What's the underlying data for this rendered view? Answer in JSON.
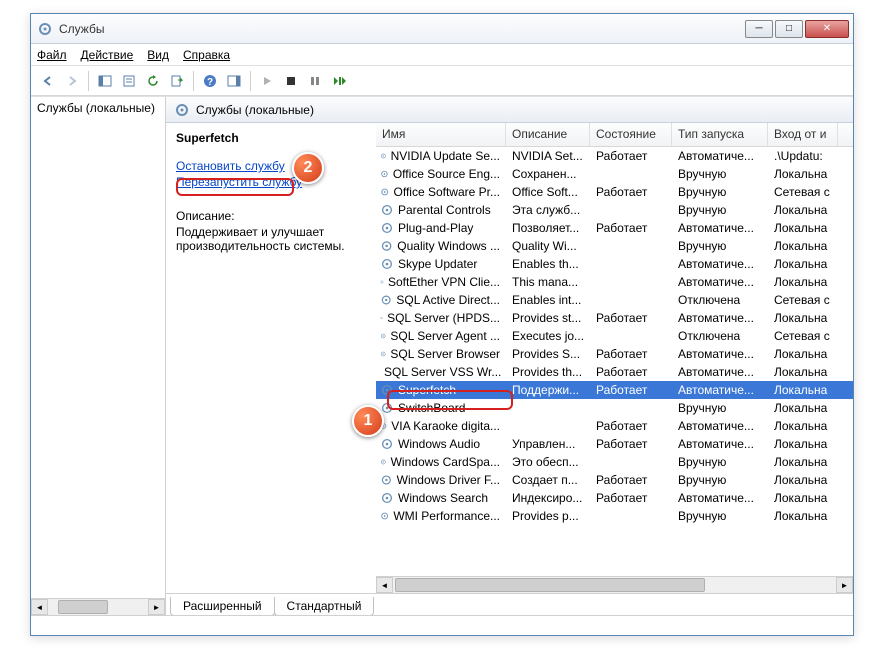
{
  "window": {
    "title": "Службы"
  },
  "menus": {
    "file": "Файл",
    "action": "Действие",
    "view": "Вид",
    "help": "Справка"
  },
  "left": {
    "label": "Службы (локальные)"
  },
  "header": {
    "label": "Службы (локальные)"
  },
  "detail": {
    "name": "Superfetch",
    "stop": "Остановить службу",
    "restart": "Перезапустить службу",
    "desc_label": "Описание:",
    "desc": "Поддерживает и улучшает производительность системы."
  },
  "columns": {
    "name": "Имя",
    "desc": "Описание",
    "state": "Состояние",
    "startup": "Тип запуска",
    "logon": "Вход от и"
  },
  "services": [
    {
      "name": "NVIDIA Update Se...",
      "desc": "NVIDIA Set...",
      "state": "Работает",
      "startup": "Автоматиче...",
      "logon": ".\\Updatu:"
    },
    {
      "name": "Office  Source Eng...",
      "desc": "Сохранен...",
      "state": "",
      "startup": "Вручную",
      "logon": "Локальна"
    },
    {
      "name": "Office Software Pr...",
      "desc": "Office Soft...",
      "state": "Работает",
      "startup": "Вручную",
      "logon": "Сетевая с"
    },
    {
      "name": "Parental Controls",
      "desc": "Эта служб...",
      "state": "",
      "startup": "Вручную",
      "logon": "Локальна"
    },
    {
      "name": "Plug-and-Play",
      "desc": "Позволяет...",
      "state": "Работает",
      "startup": "Автоматиче...",
      "logon": "Локальна"
    },
    {
      "name": "Quality Windows ...",
      "desc": "Quality Wi...",
      "state": "",
      "startup": "Вручную",
      "logon": "Локальна"
    },
    {
      "name": "Skype Updater",
      "desc": "Enables th...",
      "state": "",
      "startup": "Автоматиче...",
      "logon": "Локальна"
    },
    {
      "name": "SoftEther VPN Clie...",
      "desc": "This mana...",
      "state": "",
      "startup": "Автоматиче...",
      "logon": "Локальна"
    },
    {
      "name": "SQL Active Direct...",
      "desc": "Enables int...",
      "state": "",
      "startup": "Отключена",
      "logon": "Сетевая с"
    },
    {
      "name": "SQL Server (HPDS...",
      "desc": "Provides st...",
      "state": "Работает",
      "startup": "Автоматиче...",
      "logon": "Локальна"
    },
    {
      "name": "SQL Server Agent ...",
      "desc": "Executes jo...",
      "state": "",
      "startup": "Отключена",
      "logon": "Сетевая с"
    },
    {
      "name": "SQL Server Browser",
      "desc": "Provides S...",
      "state": "Работает",
      "startup": "Автоматиче...",
      "logon": "Локальна"
    },
    {
      "name": "SQL Server VSS Wr...",
      "desc": "Provides th...",
      "state": "Работает",
      "startup": "Автоматиче...",
      "logon": "Локальна"
    },
    {
      "name": "Superfetch",
      "desc": "Поддержи...",
      "state": "Работает",
      "startup": "Автоматиче...",
      "logon": "Локальна",
      "selected": true
    },
    {
      "name": "SwitchBoard",
      "desc": "",
      "state": "",
      "startup": "Вручную",
      "logon": "Локальна"
    },
    {
      "name": "VIA Karaoke digita...",
      "desc": "",
      "state": "Работает",
      "startup": "Автоматиче...",
      "logon": "Локальна"
    },
    {
      "name": "Windows Audio",
      "desc": "Управлен...",
      "state": "Работает",
      "startup": "Автоматиче...",
      "logon": "Локальна"
    },
    {
      "name": "Windows CardSpa...",
      "desc": "Это обесп...",
      "state": "",
      "startup": "Вручную",
      "logon": "Локальна"
    },
    {
      "name": "Windows Driver F...",
      "desc": "Создает п...",
      "state": "Работает",
      "startup": "Вручную",
      "logon": "Локальна"
    },
    {
      "name": "Windows Search",
      "desc": "Индексиро...",
      "state": "Работает",
      "startup": "Автоматиче...",
      "logon": "Локальна"
    },
    {
      "name": "WMI Performance...",
      "desc": "Provides p...",
      "state": "",
      "startup": "Вручную",
      "logon": "Локальна"
    }
  ],
  "tabs": {
    "ext": "Расширенный",
    "std": "Стандартный"
  },
  "callouts": {
    "one": "1",
    "two": "2"
  }
}
